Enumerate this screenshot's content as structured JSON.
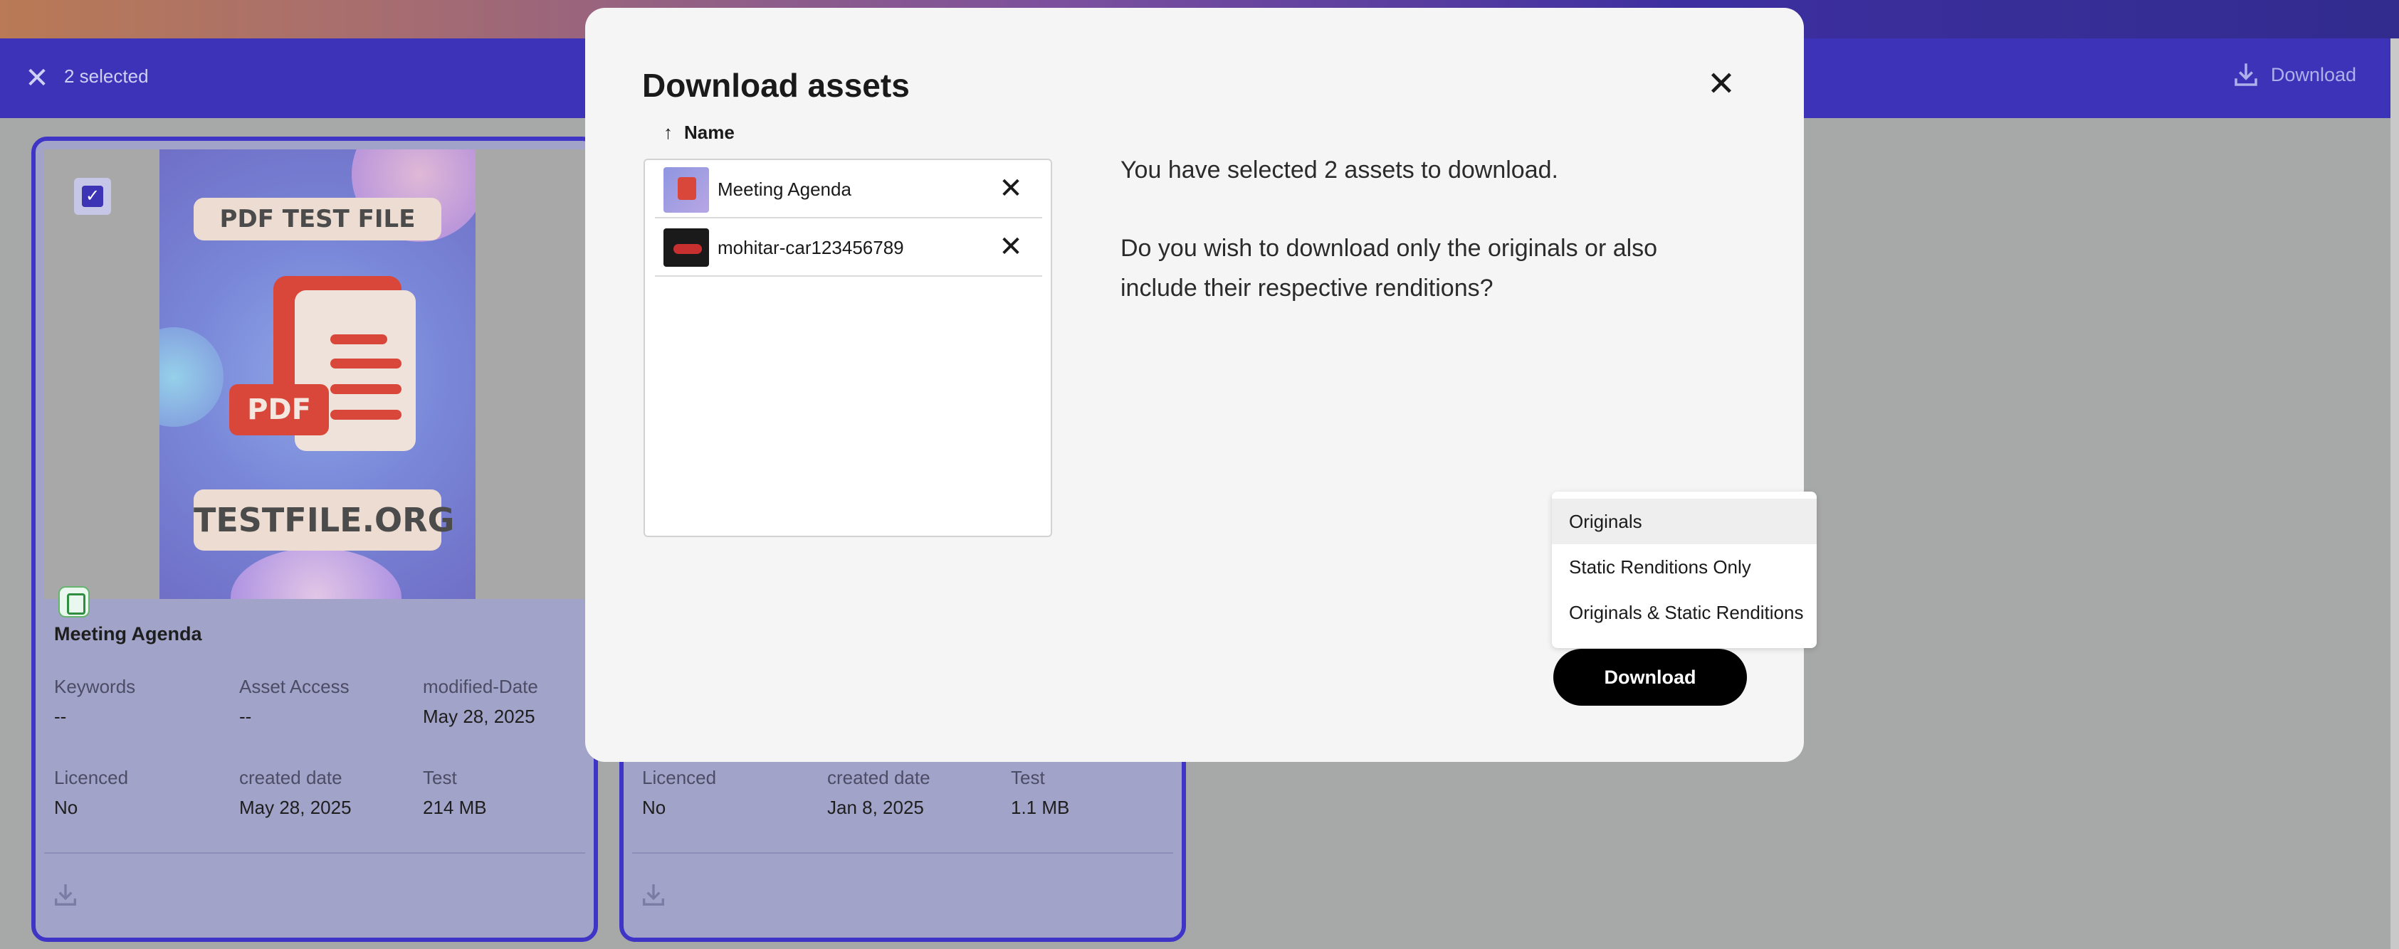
{
  "selection_bar": {
    "count_text": "2 selected",
    "download_label": "Download",
    "close_icon": "close-icon",
    "download_icon": "download-icon"
  },
  "cards": [
    {
      "poster_top": "PDF TEST FILE",
      "poster_tag": "PDF",
      "poster_bottom": "TESTFILE.ORG",
      "title": "Meeting Agenda",
      "fields": [
        {
          "label": "Keywords",
          "value": "--"
        },
        {
          "label": "Asset Access",
          "value": "--"
        },
        {
          "label": "modified-Date",
          "value": "May 28, 2025"
        },
        {
          "label": "Licenced",
          "value": "No"
        },
        {
          "label": "created date",
          "value": "May 28, 2025"
        },
        {
          "label": "Test",
          "value": "214 MB"
        }
      ]
    },
    {
      "fields": [
        {
          "label": "Licenced",
          "value": "No"
        },
        {
          "label": "created date",
          "value": "Jan 8, 2025"
        },
        {
          "label": "Test",
          "value": "1.1 MB"
        }
      ]
    }
  ],
  "modal": {
    "title": "Download assets",
    "column_header": "Name",
    "sort_icon": "arrow-up-icon",
    "assets": [
      {
        "name": "Meeting Agenda"
      },
      {
        "name": "mohitar-car123456789"
      }
    ],
    "message_line1": "You have selected 2 assets to download.",
    "message_line2": "Do you wish to download only the originals or also",
    "message_line3": "include their respective renditions?",
    "menu_options": [
      "Originals",
      "Static Renditions Only",
      "Originals & Static Renditions"
    ],
    "selected_option": "Originals",
    "download_button": "Download"
  },
  "colors": {
    "selection_bar": "#3d33b8",
    "card_border": "#3e35c6",
    "primary_button": "#000000"
  }
}
